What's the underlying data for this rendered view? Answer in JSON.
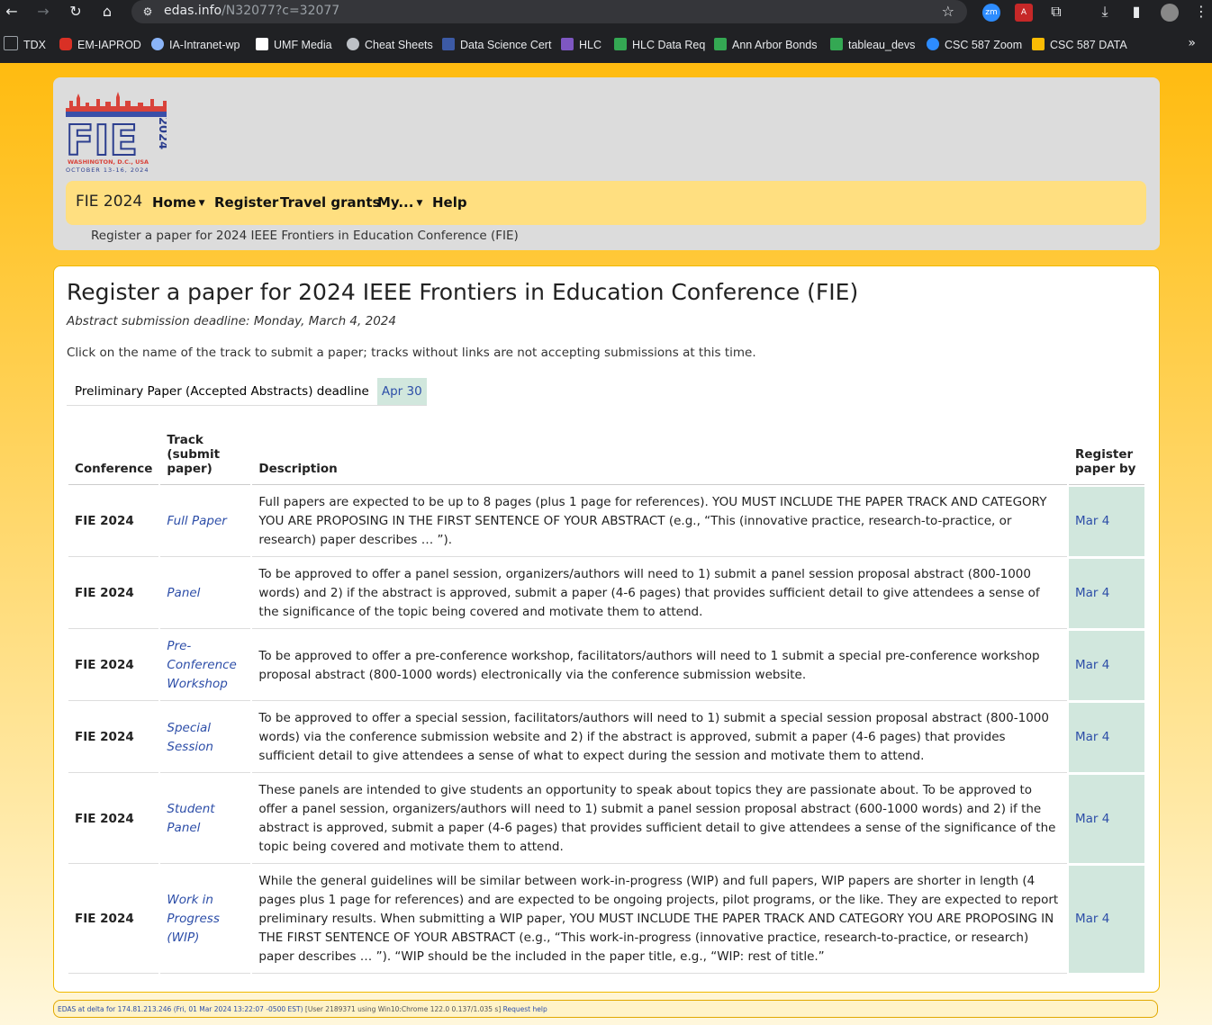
{
  "browser": {
    "url_host": "edas.info",
    "url_path": "/N32077?c=32077",
    "bookmarks": [
      {
        "label": "TDX",
        "color": "#9aa0a6"
      },
      {
        "label": "EM-IAPROD",
        "color": "#d93025"
      },
      {
        "label": "IA-Intranet-wp",
        "color": "#8ab4f8"
      },
      {
        "label": "UMF Media",
        "color": "#ffffff"
      },
      {
        "label": "Cheat Sheets",
        "color": "#bdc1c6"
      },
      {
        "label": "Data Science Cert",
        "color": "#3c5aa6"
      },
      {
        "label": "HLC",
        "color": "#7e57c2"
      },
      {
        "label": "HLC Data Req",
        "color": "#34a853"
      },
      {
        "label": "Ann Arbor Bonds",
        "color": "#34a853"
      },
      {
        "label": "tableau_devs",
        "color": "#34a853"
      },
      {
        "label": "CSC 587 Zoom",
        "color": "#2d8cff"
      },
      {
        "label": "CSC 587 DATA",
        "color": "#fbbc04"
      }
    ]
  },
  "header": {
    "logo_text": "FIE",
    "logo_year": "2024",
    "logo_city": "WASHINGTON, D.C., USA",
    "logo_dates": "OCTOBER 13-16, 2024",
    "brand": "FIE 2024",
    "nav": {
      "home": "Home",
      "register": "Register",
      "travel": "Travel grants",
      "my": "My...",
      "help": "Help"
    },
    "breadcrumb": "Register a paper for 2024 IEEE Frontiers in Education Conference (FIE)"
  },
  "main": {
    "title": "Register a paper for 2024 IEEE Frontiers in Education Conference (FIE)",
    "deadline": "Abstract submission deadline: Monday, March 4, 2024",
    "instructions": "Click on the name of the track to submit a paper; tracks without links are not accepting submissions at this time.",
    "deadline_row": {
      "label": "Preliminary Paper (Accepted Abstracts) deadline",
      "date": "Apr 30"
    },
    "columns": {
      "conference": "Conference",
      "track": "Track (submit paper)",
      "description": "Description",
      "register_by": "Register paper by"
    },
    "rows": [
      {
        "conference": "FIE 2024",
        "track": "Full Paper",
        "description": "Full papers are expected to be up to 8 pages (plus 1 page for references). YOU MUST INCLUDE THE PAPER TRACK AND CATEGORY YOU ARE PROPOSING IN THE FIRST SENTENCE OF YOUR ABSTRACT (e.g., “This (innovative practice, research-to-practice, or research) paper describes … ”).",
        "register_by": "Mar 4"
      },
      {
        "conference": "FIE 2024",
        "track": "Panel",
        "description": "To be approved to offer a panel session, organizers/authors will need to 1) submit a panel session proposal abstract (800-1000 words) and 2) if the abstract is approved, submit a paper (4-6 pages) that provides sufficient detail to give attendees a sense of the significance of the topic being covered and motivate them to attend.",
        "register_by": "Mar 4"
      },
      {
        "conference": "FIE 2024",
        "track": "Pre-Conference Workshop",
        "description": "To be approved to offer a pre-conference workshop, facilitators/authors will need to 1 submit a special pre-conference workshop proposal abstract (800-1000 words) electronically via the conference submission website.",
        "register_by": "Mar 4"
      },
      {
        "conference": "FIE 2024",
        "track": "Special Session",
        "description": "To be approved to offer a special session, facilitators/authors will need to 1) submit a special session proposal abstract (800-1000 words) via the conference submission website and 2) if the abstract is approved, submit a paper (4-6 pages) that provides sufficient detail to give attendees a sense of what to expect during the session and motivate them to attend.",
        "register_by": "Mar 4"
      },
      {
        "conference": "FIE 2024",
        "track": "Student Panel",
        "description": "These panels are intended to give students an opportunity to speak about topics they are passionate about. To be approved to offer a panel session, organizers/authors will need to 1) submit a panel session proposal abstract (600-1000 words) and 2) if the abstract is approved, submit a paper (4-6 pages) that provides sufficient detail to give attendees a sense of the significance of the topic being covered and motivate them to attend.",
        "register_by": "Mar 4"
      },
      {
        "conference": "FIE 2024",
        "track": "Work in Progress (WIP)",
        "description": "While the general guidelines will be similar between work-in-progress (WIP) and full papers, WIP papers are shorter in length (4 pages plus 1 page for references) and are expected to be ongoing projects, pilot programs, or the like. They are expected to report preliminary results. When submitting a WIP paper, YOU MUST INCLUDE THE PAPER TRACK AND CATEGORY YOU ARE PROPOSING IN THE FIRST SENTENCE OF YOUR ABSTRACT (e.g., “This work-in-progress (innovative practice, research-to-practice, or research) paper describes … ”). “WIP should be the included in the paper title, e.g., “WIP: rest of title.”",
        "register_by": "Mar 4"
      }
    ]
  },
  "footer": {
    "host": "EDAS at delta for 174.81.213.246",
    "timestamp": "(Fri, 01 Mar 2024 13:22:07 -0500 EST)",
    "user": "[User 2189371 using Win10:Chrome 122.0 0.137/1.035 s]",
    "help": "Request help"
  }
}
